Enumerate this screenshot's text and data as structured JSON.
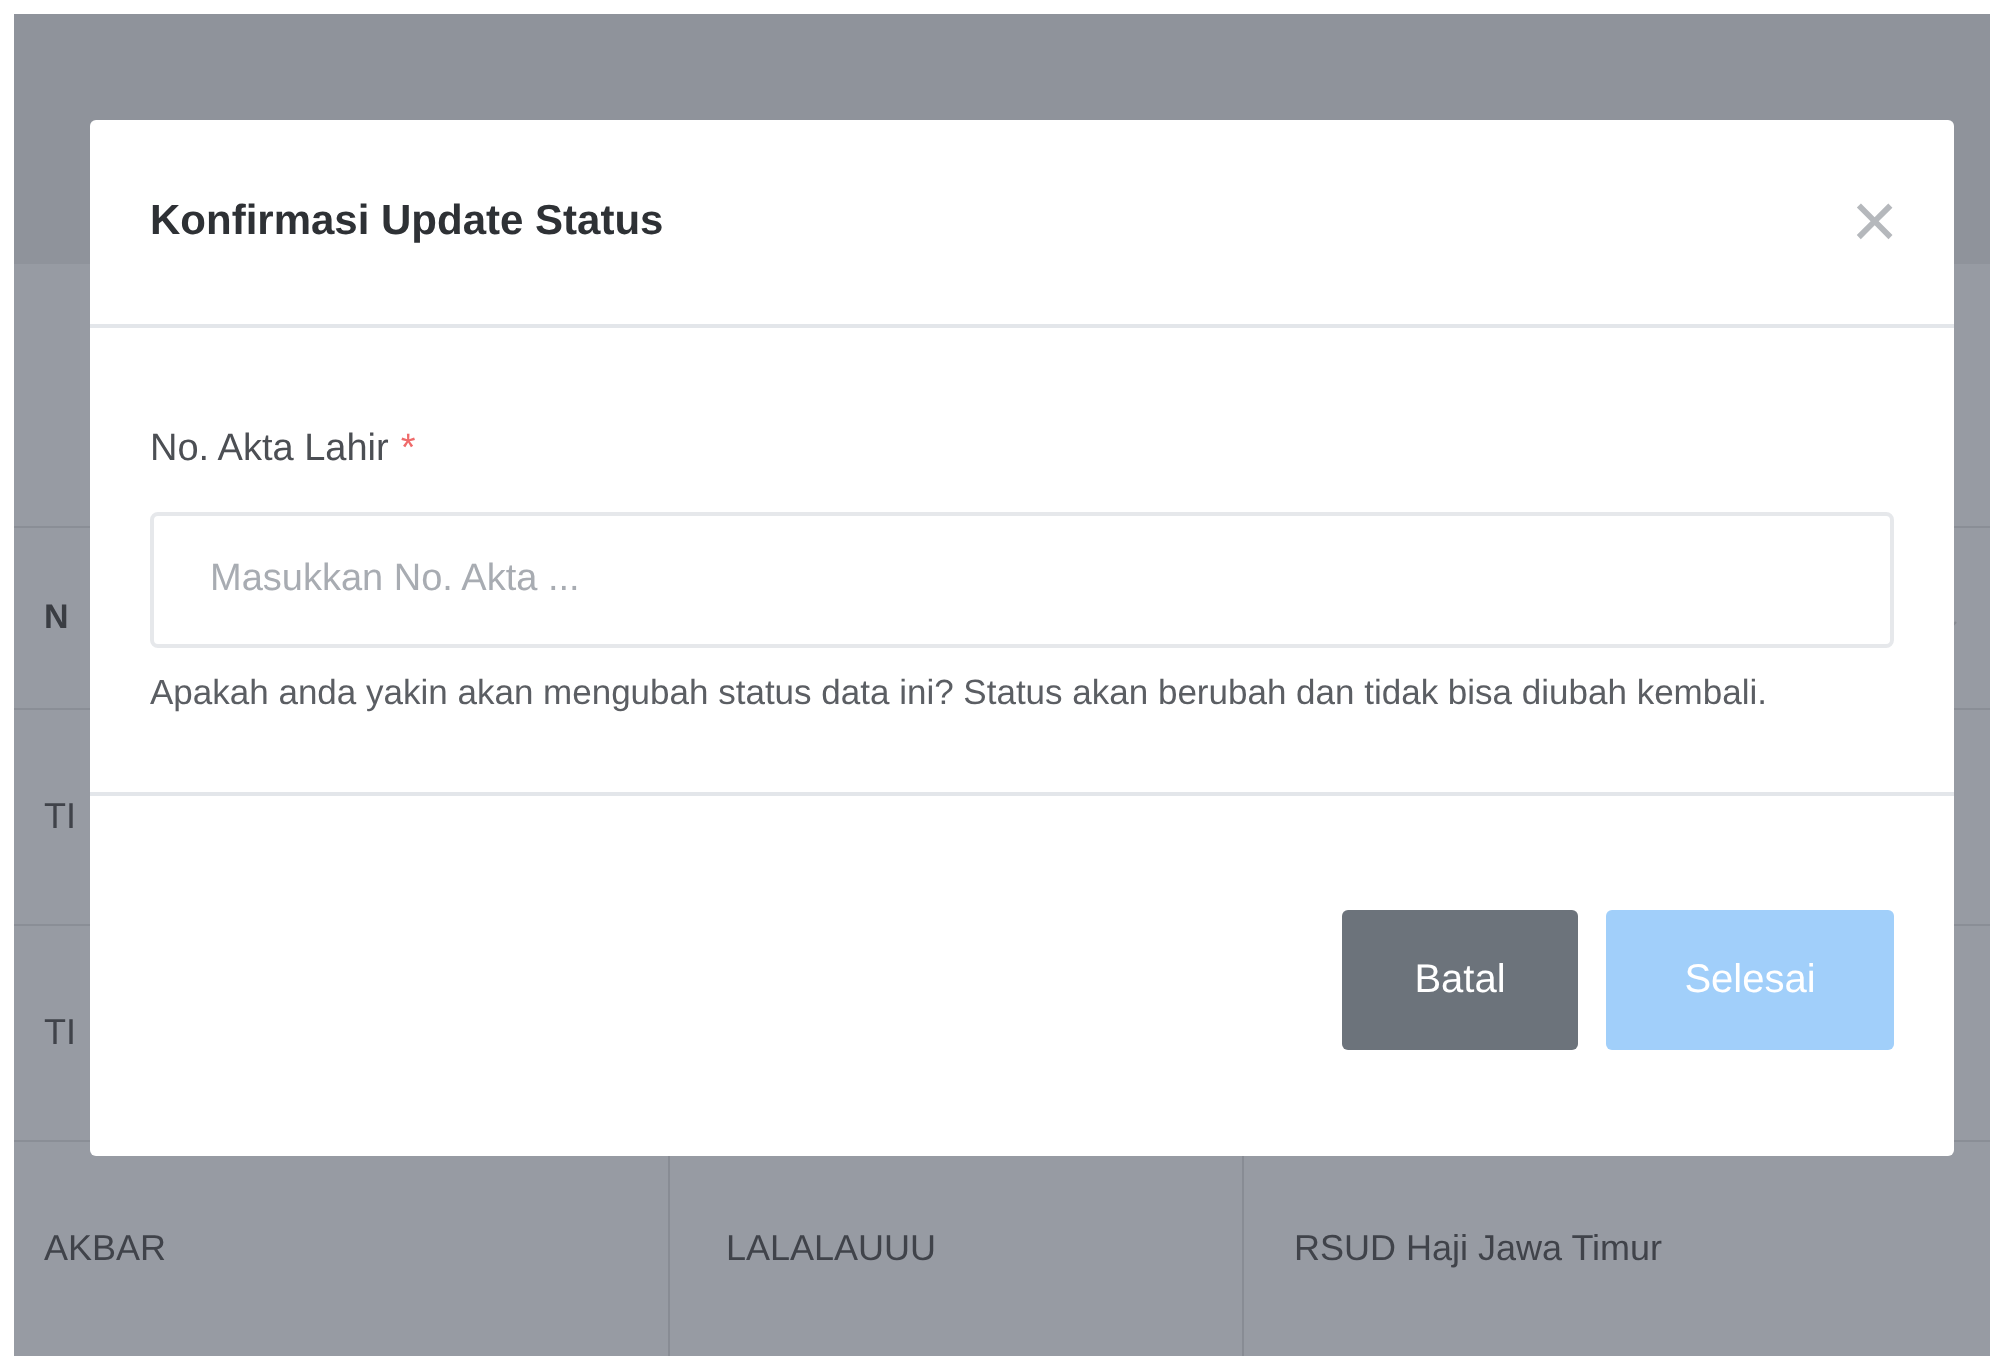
{
  "table": {
    "header_cells": [
      "N"
    ],
    "rows": [
      {
        "cells": [
          "TI"
        ]
      },
      {
        "cells": [
          "TI"
        ]
      },
      {
        "cells": [
          "AKBAR",
          "LALALAUUU",
          "RSUD Haji Jawa Timur"
        ]
      }
    ]
  },
  "modal": {
    "title": "Konfirmasi Update Status",
    "close": "×",
    "field": {
      "label": "No. Akta Lahir",
      "required": true,
      "required_mark": "*",
      "placeholder": "Masukkan No. Akta ..."
    },
    "message": "Apakah anda yakin akan mengubah status data ini? Status akan berubah dan tidak bisa diubah kembali.",
    "buttons": [
      {
        "label": "Batal",
        "kind": "secondary",
        "disabled": false
      },
      {
        "label": "Selesai",
        "kind": "primary",
        "disabled": true
      }
    ]
  }
}
